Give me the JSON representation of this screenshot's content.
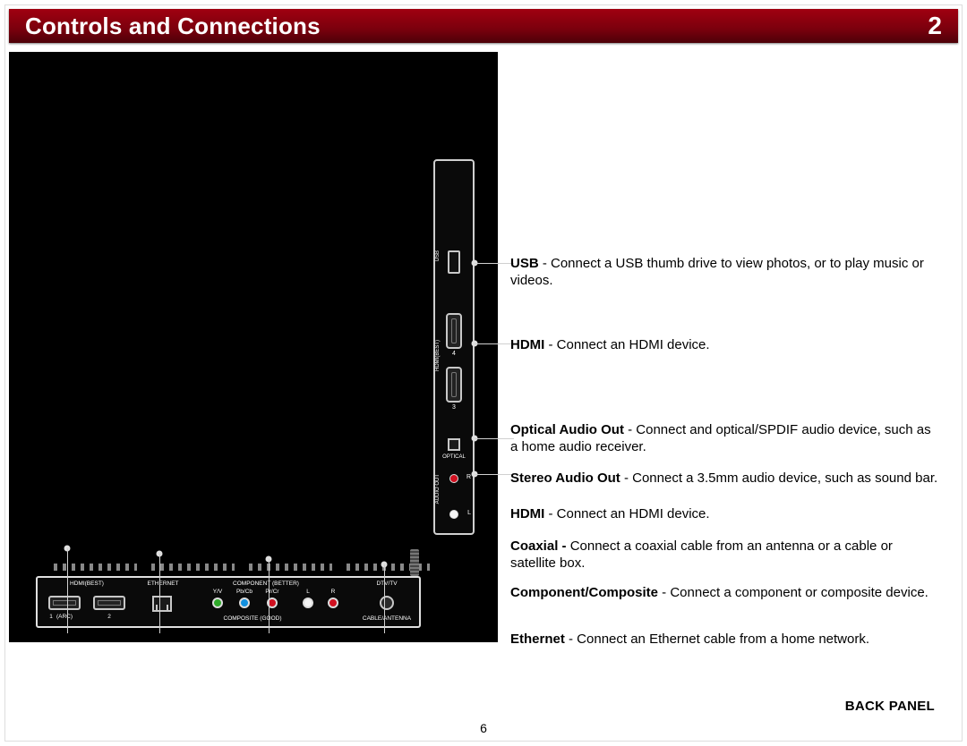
{
  "header": {
    "title": "Controls and Connections",
    "chapter": "2"
  },
  "side_labels": {
    "usb": "USB",
    "hdmi_best": "HDMI(BEST)",
    "audio_out": "AUDIO OUT",
    "optical": "OPTICAL",
    "n4": "4",
    "n3": "3",
    "r": "R",
    "l": "L"
  },
  "bottom_labels": {
    "hdmi_best": "HDMI(BEST)",
    "one_arc": "1",
    "arc": "(ARC)",
    "two": "2",
    "ethernet": "ETHERNET",
    "component": "COMPONENT (BETTER)",
    "composite": "COMPOSITE (GOOD)",
    "yv": "Y/V",
    "pbcb": "Pb/Cb",
    "prcr": "Pr/Cr",
    "l": "L",
    "r": "R",
    "dtv": "DTV/TV",
    "cable_ant": "CABLE/ANTENNA"
  },
  "descriptions": [
    {
      "bold": "USB",
      "text": " - Connect a USB thumb drive to view photos, or to play music or videos."
    },
    {
      "bold": "HDMI",
      "text": " - Connect an HDMI device."
    },
    {
      "bold": "Optical Audio Out",
      "text": " - Connect and optical/SPDIF audio device, such as a home audio receiver."
    },
    {
      "bold": "Stereo Audio Out",
      "text": " - Connect a 3.5mm audio device, such as sound bar."
    },
    {
      "bold": "HDMI",
      "text": " - Connect an HDMI device."
    },
    {
      "bold": "Coaxial - ",
      "text": "Connect a coaxial cable from an antenna or a cable or satellite box."
    },
    {
      "bold": "Component/Composite",
      "text": " - Connect a component or composite device."
    },
    {
      "bold": "Ethernet",
      "text": " - Connect an Ethernet cable from a home network."
    }
  ],
  "footer": {
    "label": "BACK PANEL",
    "page": "6"
  },
  "colors": {
    "green": "#2faa2a",
    "blue": "#1290e0",
    "red": "#d01020",
    "white": "#f4f4f4",
    "black": "#111"
  }
}
